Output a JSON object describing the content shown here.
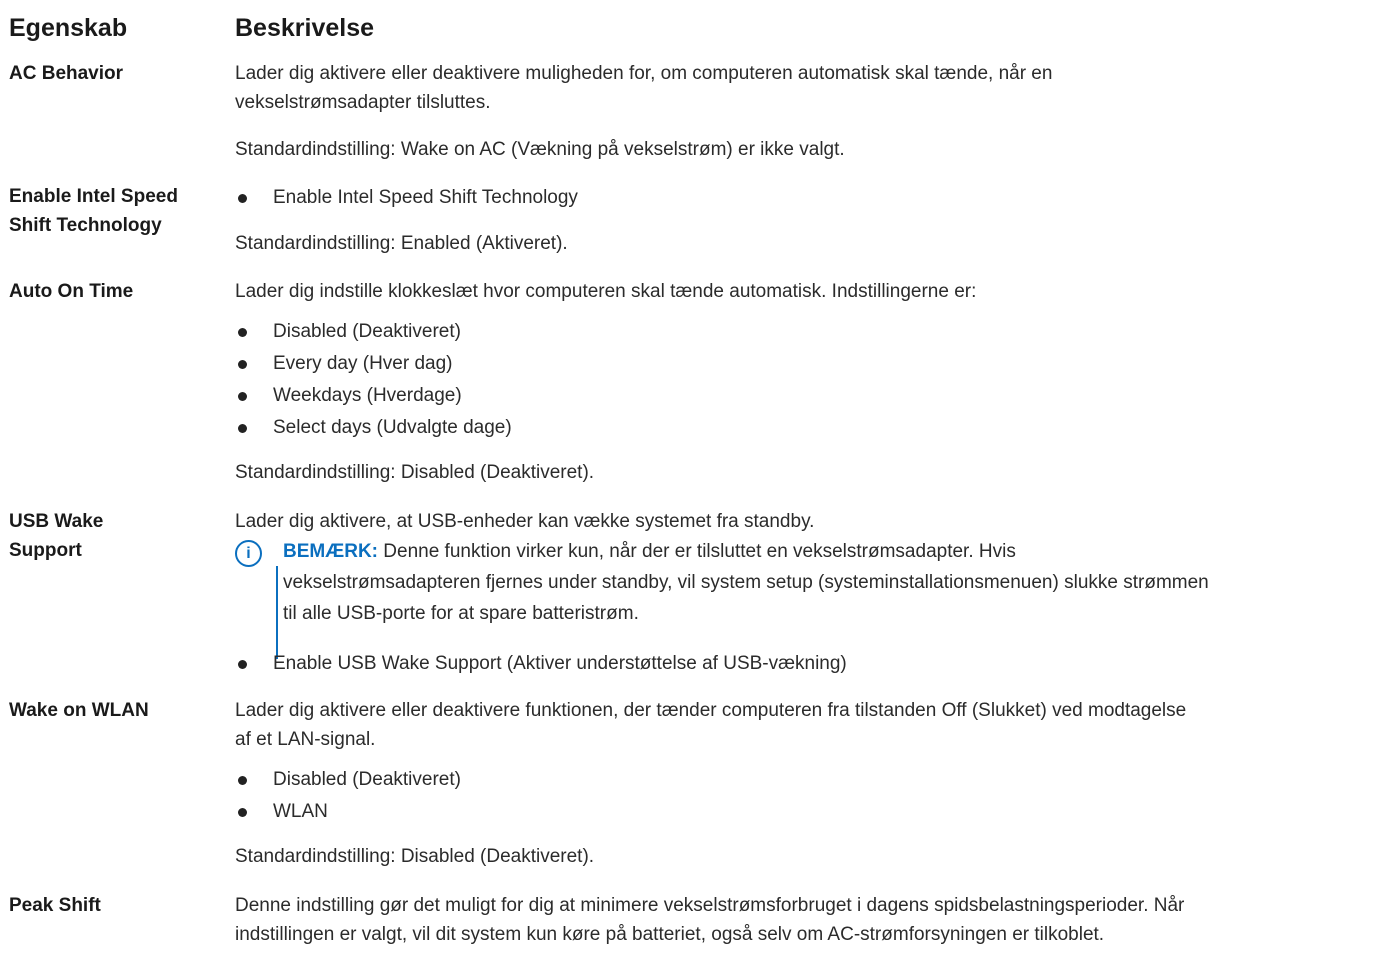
{
  "header": {
    "property": "Egenskab",
    "description": "Beskrivelse"
  },
  "rows": [
    {
      "property": "AC Behavior",
      "lines": [
        "Lader dig aktivere eller deaktivere muligheden for, om computeren automatisk skal tænde, når en",
        "vekselstrømsadapter tilsluttes."
      ],
      "default": "Standardindstilling: Wake on AC (Vækning på vekselstrøm) er ikke valgt."
    },
    {
      "property_lines": [
        "Enable Intel Speed",
        "Shift Technology"
      ],
      "bullets": [
        "Enable Intel Speed Shift Technology"
      ],
      "default": "Standardindstilling: Enabled (Aktiveret)."
    },
    {
      "property": "Auto On Time",
      "intro": "Lader dig indstille klokkeslæt hvor computeren skal tænde automatisk. Indstillingerne er:",
      "bullets": [
        "Disabled (Deaktiveret)",
        "Every day (Hver dag)",
        "Weekdays (Hverdage)",
        "Select days (Udvalgte dage)"
      ],
      "default": "Standardindstilling: Disabled (Deaktiveret)."
    },
    {
      "property_lines": [
        "USB Wake",
        "Support"
      ],
      "intro": "Lader dig aktivere, at USB-enheder kan vække systemet fra standby.",
      "note": {
        "icon": "info-icon",
        "label": "BEMÆRK:",
        "line1": " Denne funktion virker kun, når der er tilsluttet en vekselstrømsadapter. Hvis",
        "line2": "vekselstrømsadapteren fjernes under standby, vil system setup (systeminstallationsmenuen) slukke strømmen",
        "line3": "til alle USB-porte for at spare batteristrøm."
      },
      "bullets": [
        "Enable USB Wake Support (Aktiver understøttelse af USB-vækning)"
      ]
    },
    {
      "property": "Wake on WLAN",
      "lines": [
        "Lader dig aktivere eller deaktivere funktionen, der tænder computeren fra tilstanden Off (Slukket) ved modtagelse",
        "af et LAN-signal."
      ],
      "bullets": [
        "Disabled (Deaktiveret)",
        "WLAN"
      ],
      "default": "Standardindstilling: Disabled (Deaktiveret)."
    },
    {
      "property": "Peak Shift",
      "lines": [
        "Denne indstilling gør det muligt for dig at minimere vekselstrømsforbruget i dagens spidsbelastningsperioder. Når",
        "indstillingen er valgt, vil dit system kun køre på batteriet, også selv om AC-strømforsyningen er tilkoblet."
      ]
    }
  ],
  "colors": {
    "text": "#222222",
    "note_accent": "#0b6fbf"
  }
}
